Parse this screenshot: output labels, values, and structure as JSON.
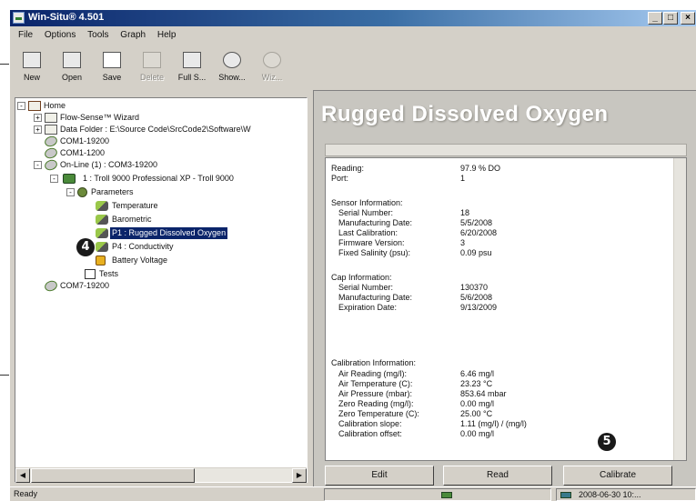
{
  "window": {
    "title": "Win-Situ® 4.501",
    "min": "_",
    "max": "□",
    "close": "×"
  },
  "menu": [
    "File",
    "Options",
    "Tools",
    "Graph",
    "Help"
  ],
  "toolbar": [
    {
      "label": "New",
      "icon": "new-icon",
      "enabled": true
    },
    {
      "label": "Open",
      "icon": "open-icon",
      "enabled": true
    },
    {
      "label": "Save",
      "icon": "save-icon",
      "enabled": true
    },
    {
      "label": "Delete",
      "icon": "delete-icon",
      "enabled": false
    },
    {
      "label": "Full S...",
      "icon": "full-screen-icon",
      "enabled": true
    },
    {
      "label": "Show...",
      "icon": "show-icon",
      "enabled": true
    },
    {
      "label": "Wiz...",
      "icon": "wizard-icon",
      "enabled": false
    }
  ],
  "tree": [
    {
      "label": "Home",
      "icon": "home-icon",
      "expander": "-"
    },
    {
      "label": "Flow-Sense™ Wizard",
      "icon": "folder-icon",
      "expander": "+"
    },
    {
      "label": "Data Folder : E:\\Source Code\\SrcCode2\\Software\\W",
      "icon": "folder-icon",
      "expander": "+"
    },
    {
      "label": "COM1-19200",
      "icon": "cable-icon",
      "expander": ""
    },
    {
      "label": "COM1-1200",
      "icon": "cable-icon",
      "expander": ""
    },
    {
      "label": "On-Line (1) : COM3-19200",
      "icon": "cable-icon",
      "expander": "-"
    },
    {
      "label": "1 : Troll 9000 Professional XP - Troll 9000",
      "icon": "device-icon",
      "expander": "-"
    },
    {
      "label": "Parameters",
      "icon": "parameters-icon",
      "expander": "-"
    },
    {
      "label": "Temperature",
      "icon": "probe-icon",
      "expander": ""
    },
    {
      "label": "Barometric",
      "icon": "probe-icon",
      "expander": ""
    },
    {
      "label": "P1 : Rugged Dissolved Oxygen",
      "icon": "probe-icon",
      "expander": "",
      "selected": true
    },
    {
      "label": "P4 : Conductivity",
      "icon": "probe-icon",
      "expander": ""
    },
    {
      "label": "Battery Voltage",
      "icon": "battery-icon",
      "expander": ""
    },
    {
      "label": "Tests",
      "icon": "tests-icon",
      "expander": ""
    },
    {
      "label": "COM7-19200",
      "icon": "cable-icon",
      "expander": ""
    }
  ],
  "callouts": {
    "tree": "4",
    "calibrate": "5"
  },
  "panel": {
    "heading": "Rugged Dissolved Oxygen",
    "rows": [
      {
        "label": "Reading:",
        "value": "97.9 % DO"
      },
      {
        "label": "Port:",
        "value": "1"
      },
      {
        "label": "",
        "value": ""
      },
      {
        "label": "Sensor Information:",
        "value": ""
      },
      {
        "label": "   Serial Number:",
        "value": "18"
      },
      {
        "label": "   Manufacturing Date:",
        "value": "5/5/2008"
      },
      {
        "label": "   Last Calibration:",
        "value": "6/20/2008"
      },
      {
        "label": "   Firmware Version:",
        "value": "3"
      },
      {
        "label": "   Fixed Salinity (psu):",
        "value": "0.09 psu"
      },
      {
        "label": "",
        "value": ""
      },
      {
        "label": "Cap Information:",
        "value": ""
      },
      {
        "label": "   Serial Number:",
        "value": "130370"
      },
      {
        "label": "   Manufacturing Date:",
        "value": "5/6/2008"
      },
      {
        "label": "   Expiration Date:",
        "value": "9/13/2009"
      },
      {
        "label": "",
        "value": ""
      },
      {
        "label": "Calibration Information:",
        "value": ""
      },
      {
        "label": "   Air Reading (mg/l):",
        "value": "6.46 mg/l"
      },
      {
        "label": "   Air Temperature (C):",
        "value": "23.23 °C"
      },
      {
        "label": "   Air Pressure (mbar):",
        "value": "853.64 mbar"
      },
      {
        "label": "   Zero Reading (mg/l):",
        "value": "0.00 mg/l"
      },
      {
        "label": "   Zero Temperature (C):",
        "value": "25.00 °C"
      },
      {
        "label": "   Calibration slope:",
        "value": "1.11 (mg/l) / (mg/l)"
      },
      {
        "label": "   Calibration offset:",
        "value": "0.00 mg/l"
      }
    ],
    "buttons": {
      "edit": "Edit",
      "read": "Read",
      "calibrate": "Calibrate"
    }
  },
  "status": {
    "ready": "Ready",
    "datetime": "2008-06-30 10:..."
  }
}
